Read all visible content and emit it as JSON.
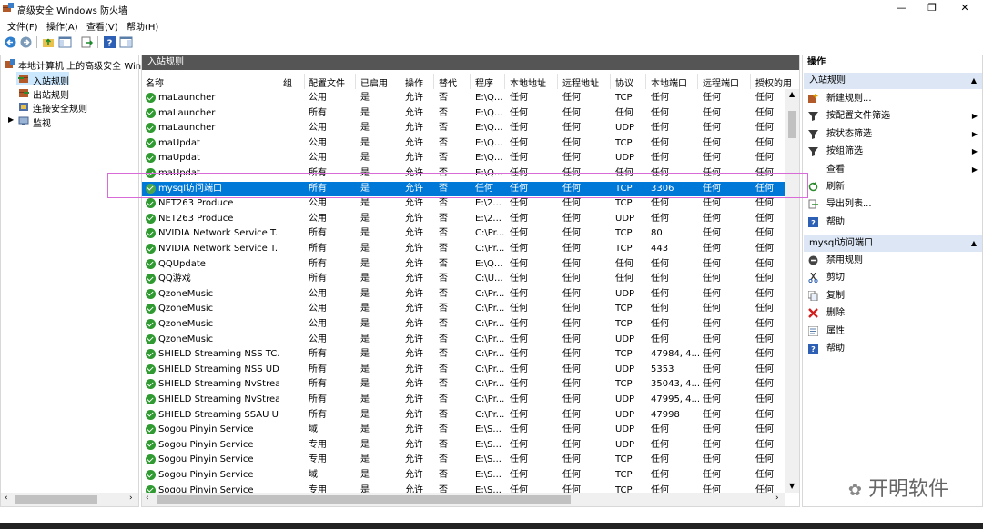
{
  "window": {
    "title": "高级安全 Windows 防火墙",
    "min": "—",
    "restore": "❐",
    "close": "✕"
  },
  "menu": [
    "文件(F)",
    "操作(A)",
    "查看(V)",
    "帮助(H)"
  ],
  "tree": {
    "root": "本地计算机 上的高级安全 Windo",
    "items": [
      "入站规则",
      "出站规则",
      "连接安全规则",
      "监视"
    ]
  },
  "center": {
    "header": "入站规则",
    "columns": [
      "名称",
      "组",
      "配置文件",
      "已启用",
      "操作",
      "替代",
      "程序",
      "本地地址",
      "远程地址",
      "协议",
      "本地端口",
      "远程端口",
      "授权的用"
    ],
    "rows": [
      [
        "maLauncher",
        "",
        "公用",
        "是",
        "允许",
        "否",
        "E:\\Q...",
        "任何",
        "任何",
        "TCP",
        "任何",
        "任何",
        "任何"
      ],
      [
        "maLauncher",
        "",
        "所有",
        "是",
        "允许",
        "否",
        "E:\\Q...",
        "任何",
        "任何",
        "任何",
        "任何",
        "任何",
        "任何"
      ],
      [
        "maLauncher",
        "",
        "公用",
        "是",
        "允许",
        "否",
        "E:\\Q...",
        "任何",
        "任何",
        "UDP",
        "任何",
        "任何",
        "任何"
      ],
      [
        "maUpdat",
        "",
        "公用",
        "是",
        "允许",
        "否",
        "E:\\Q...",
        "任何",
        "任何",
        "TCP",
        "任何",
        "任何",
        "任何"
      ],
      [
        "maUpdat",
        "",
        "公用",
        "是",
        "允许",
        "否",
        "E:\\Q...",
        "任何",
        "任何",
        "UDP",
        "任何",
        "任何",
        "任何"
      ],
      [
        "maUpdat",
        "",
        "所有",
        "是",
        "允许",
        "否",
        "E:\\Q...",
        "任何",
        "任何",
        "任何",
        "任何",
        "任何",
        "任何"
      ],
      [
        "mysql访问端口",
        "",
        "所有",
        "是",
        "允许",
        "否",
        "任何",
        "任何",
        "任何",
        "TCP",
        "3306",
        "任何",
        "任何"
      ],
      [
        "NET263 Produce",
        "",
        "公用",
        "是",
        "允许",
        "否",
        "E:\\2...",
        "任何",
        "任何",
        "TCP",
        "任何",
        "任何",
        "任何"
      ],
      [
        "NET263 Produce",
        "",
        "公用",
        "是",
        "允许",
        "否",
        "E:\\2...",
        "任何",
        "任何",
        "UDP",
        "任何",
        "任何",
        "任何"
      ],
      [
        "NVIDIA Network Service T...",
        "",
        "所有",
        "是",
        "允许",
        "否",
        "C:\\Pr...",
        "任何",
        "任何",
        "TCP",
        "80",
        "任何",
        "任何"
      ],
      [
        "NVIDIA Network Service T...",
        "",
        "所有",
        "是",
        "允许",
        "否",
        "C:\\Pr...",
        "任何",
        "任何",
        "TCP",
        "443",
        "任何",
        "任何"
      ],
      [
        "QQUpdate",
        "",
        "所有",
        "是",
        "允许",
        "否",
        "E:\\Q...",
        "任何",
        "任何",
        "任何",
        "任何",
        "任何",
        "任何"
      ],
      [
        "QQ游戏",
        "",
        "所有",
        "是",
        "允许",
        "否",
        "C:\\U...",
        "任何",
        "任何",
        "任何",
        "任何",
        "任何",
        "任何"
      ],
      [
        "QzoneMusic",
        "",
        "公用",
        "是",
        "允许",
        "否",
        "C:\\Pr...",
        "任何",
        "任何",
        "UDP",
        "任何",
        "任何",
        "任何"
      ],
      [
        "QzoneMusic",
        "",
        "公用",
        "是",
        "允许",
        "否",
        "C:\\Pr...",
        "任何",
        "任何",
        "TCP",
        "任何",
        "任何",
        "任何"
      ],
      [
        "QzoneMusic",
        "",
        "公用",
        "是",
        "允许",
        "否",
        "C:\\Pr...",
        "任何",
        "任何",
        "TCP",
        "任何",
        "任何",
        "任何"
      ],
      [
        "QzoneMusic",
        "",
        "公用",
        "是",
        "允许",
        "否",
        "C:\\Pr...",
        "任何",
        "任何",
        "UDP",
        "任何",
        "任何",
        "任何"
      ],
      [
        "SHIELD Streaming NSS TC...",
        "",
        "所有",
        "是",
        "允许",
        "否",
        "C:\\Pr...",
        "任何",
        "任何",
        "TCP",
        "47984, 4...",
        "任何",
        "任何"
      ],
      [
        "SHIELD Streaming NSS UD...",
        "",
        "所有",
        "是",
        "允许",
        "否",
        "C:\\Pr...",
        "任何",
        "任何",
        "UDP",
        "5353",
        "任何",
        "任何"
      ],
      [
        "SHIELD Streaming NvStrea...",
        "",
        "所有",
        "是",
        "允许",
        "否",
        "C:\\Pr...",
        "任何",
        "任何",
        "TCP",
        "35043, 4...",
        "任何",
        "任何"
      ],
      [
        "SHIELD Streaming NvStrea...",
        "",
        "所有",
        "是",
        "允许",
        "否",
        "C:\\Pr...",
        "任何",
        "任何",
        "UDP",
        "47995, 4...",
        "任何",
        "任何"
      ],
      [
        "SHIELD Streaming SSAU U...",
        "",
        "所有",
        "是",
        "允许",
        "否",
        "C:\\Pr...",
        "任何",
        "任何",
        "UDP",
        "47998",
        "任何",
        "任何"
      ],
      [
        "Sogou Pinyin Service",
        "",
        "域",
        "是",
        "允许",
        "否",
        "E:\\S...",
        "任何",
        "任何",
        "UDP",
        "任何",
        "任何",
        "任何"
      ],
      [
        "Sogou Pinyin Service",
        "",
        "专用",
        "是",
        "允许",
        "否",
        "E:\\S...",
        "任何",
        "任何",
        "UDP",
        "任何",
        "任何",
        "任何"
      ],
      [
        "Sogou Pinyin Service",
        "",
        "专用",
        "是",
        "允许",
        "否",
        "E:\\S...",
        "任何",
        "任何",
        "TCP",
        "任何",
        "任何",
        "任何"
      ],
      [
        "Sogou Pinyin Service",
        "",
        "域",
        "是",
        "允许",
        "否",
        "E:\\S...",
        "任何",
        "任何",
        "TCP",
        "任何",
        "任何",
        "任何"
      ],
      [
        "Sogou Pinyin Service",
        "",
        "专用",
        "是",
        "允许",
        "否",
        "E:\\S...",
        "任何",
        "任何",
        "TCP",
        "任何",
        "任何",
        "任何"
      ]
    ]
  },
  "actions": {
    "header": "操作",
    "section1": {
      "title": "入站规则",
      "items": [
        {
          "label": "新建规则...",
          "icon": "new-rule-icon"
        },
        {
          "label": "按配置文件筛选",
          "icon": "filter-icon",
          "submenu": true
        },
        {
          "label": "按状态筛选",
          "icon": "filter-icon",
          "submenu": true
        },
        {
          "label": "按组筛选",
          "icon": "filter-icon",
          "submenu": true
        },
        {
          "label": "查看",
          "icon": "",
          "submenu": true
        },
        {
          "label": "刷新",
          "icon": "refresh-icon"
        },
        {
          "label": "导出列表...",
          "icon": "export-icon"
        },
        {
          "label": "帮助",
          "icon": "help-icon"
        }
      ]
    },
    "section2": {
      "title": "mysql访问端口",
      "items": [
        {
          "label": "禁用规则",
          "icon": "disable-icon"
        },
        {
          "label": "剪切",
          "icon": "cut-icon"
        },
        {
          "label": "复制",
          "icon": "copy-icon"
        },
        {
          "label": "删除",
          "icon": "delete-icon"
        },
        {
          "label": "属性",
          "icon": "properties-icon"
        },
        {
          "label": "帮助",
          "icon": "help-icon"
        }
      ]
    }
  },
  "watermark": "开明软件",
  "colors": {
    "selection": "#0078d7",
    "enabled": "#2e9a30",
    "header": "#555555",
    "section": "#dce6f4"
  }
}
